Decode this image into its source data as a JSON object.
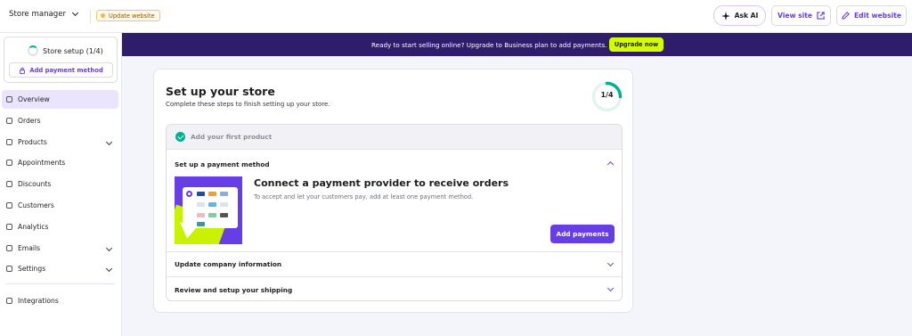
{
  "topbar": {
    "store_name": "Store manager",
    "update_badge": "Update website",
    "ask_ai": "Ask AI",
    "view_site": "View site",
    "edit_website": "Edit website"
  },
  "sidebar": {
    "setup_title": "Store setup (1/4)",
    "add_payment_button": "Add payment method",
    "items": [
      {
        "label": "Overview",
        "icon": "home-icon",
        "active": true,
        "expandable": false
      },
      {
        "label": "Orders",
        "icon": "download-icon",
        "active": false,
        "expandable": false
      },
      {
        "label": "Products",
        "icon": "tag-icon",
        "active": false,
        "expandable": true
      },
      {
        "label": "Appointments",
        "icon": "calendar-icon",
        "active": false,
        "expandable": false
      },
      {
        "label": "Discounts",
        "icon": "discount-icon",
        "active": false,
        "expandable": false
      },
      {
        "label": "Customers",
        "icon": "users-icon",
        "active": false,
        "expandable": false
      },
      {
        "label": "Analytics",
        "icon": "chart-icon",
        "active": false,
        "expandable": false
      },
      {
        "label": "Emails",
        "icon": "mail-icon",
        "active": false,
        "expandable": true
      },
      {
        "label": "Settings",
        "icon": "gear-icon",
        "active": false,
        "expandable": true
      }
    ],
    "integrations": "Integrations"
  },
  "banner": {
    "text": "Ready to start selling online? Upgrade to Business plan to add payments.",
    "button": "Upgrade now"
  },
  "setup": {
    "title": "Set up your store",
    "subtitle": "Complete these steps to finish setting up your store.",
    "progress": "1/4",
    "progress_fraction": 0.25,
    "steps": {
      "done": "Add your first product",
      "open": "Set up a payment method",
      "payment_title": "Connect a payment provider to receive orders",
      "payment_desc": "To accept and let your customers pay, add at least one payment method.",
      "payment_button": "Add payments",
      "company": "Update company information",
      "shipping": "Review and setup your shipping"
    }
  },
  "colors": {
    "accent": "#673de6",
    "banner": "#2f1c6a",
    "upgrade": "#d4ff00",
    "success": "#00b090"
  }
}
